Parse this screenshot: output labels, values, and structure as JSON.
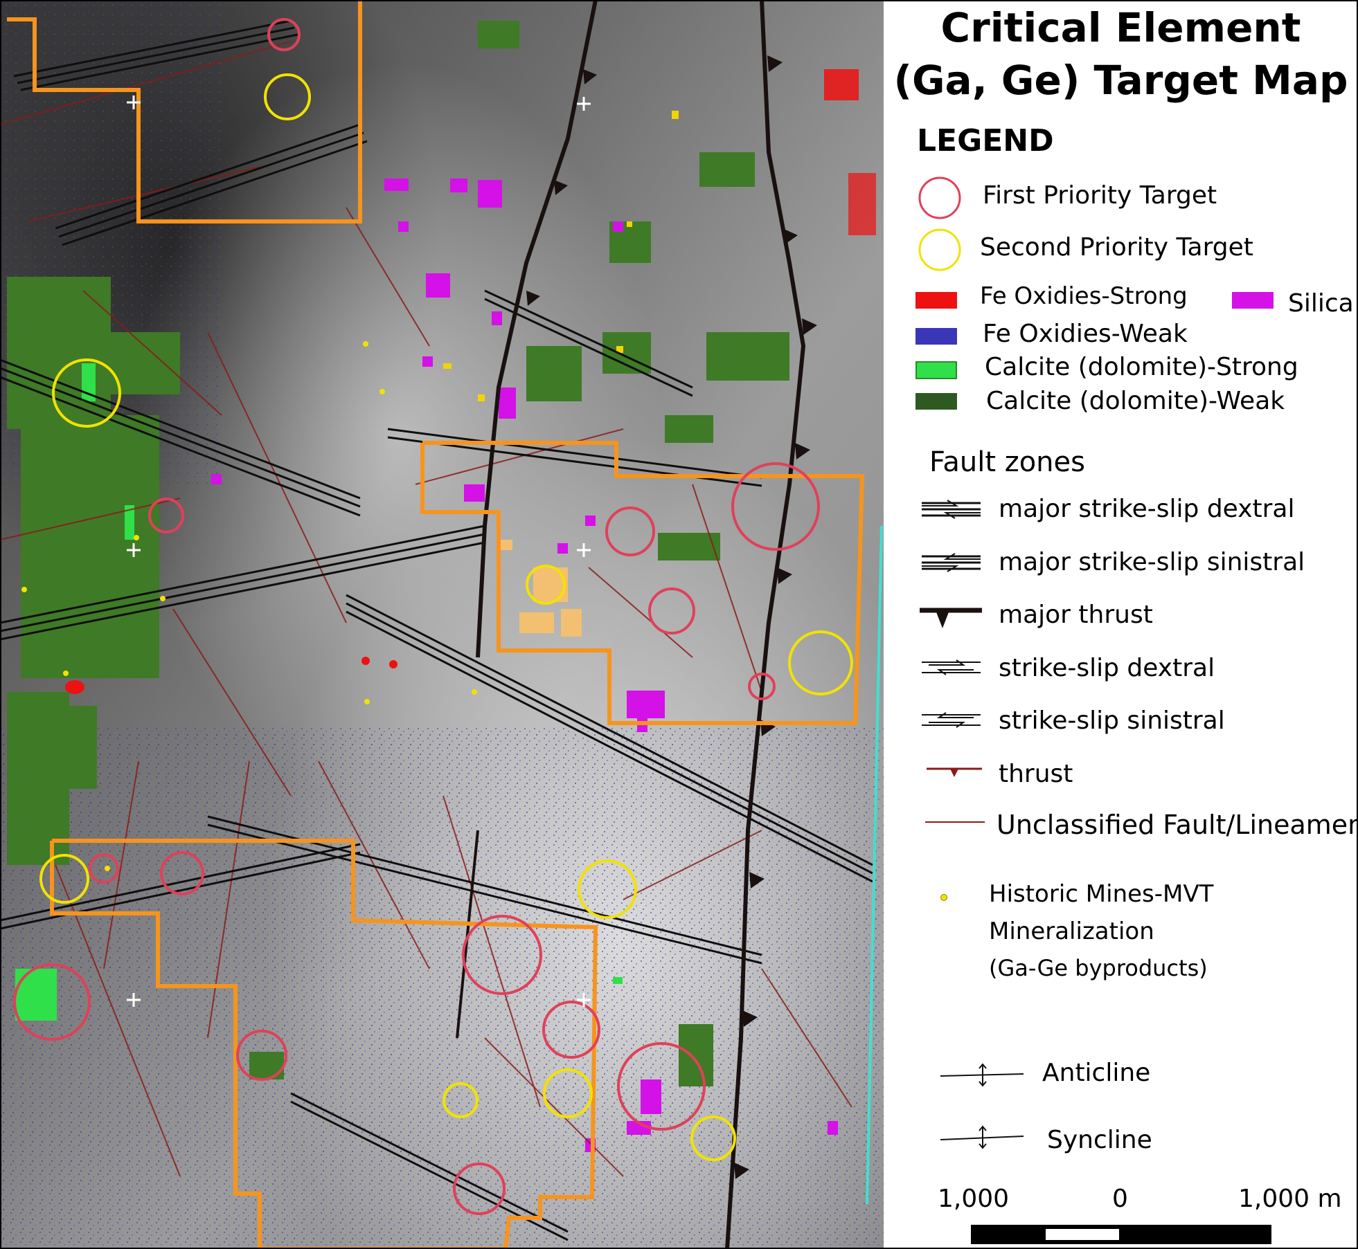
{
  "title": {
    "line1": "Critical Element",
    "line2": "(Ga, Ge) Target Map"
  },
  "legend": {
    "heading": "LEGEND",
    "items": [
      {
        "label": "First Priority Target",
        "symbol": "circle",
        "color": "#e0405a"
      },
      {
        "label": "Second Priority Target",
        "symbol": "circle",
        "color": "#f2e200"
      },
      {
        "label": "Fe Oxidies-Strong",
        "symbol": "swatch",
        "color": "#ee1111"
      },
      {
        "label": "Silica",
        "symbol": "swatch",
        "color": "#d411e6"
      },
      {
        "label": "Fe Oxidies-Weak",
        "symbol": "swatch",
        "color": "#3b35b8"
      },
      {
        "label": "Calcite (dolomite)-Strong",
        "symbol": "swatch",
        "color": "#2fe04a"
      },
      {
        "label": "Calcite (dolomite)-Weak",
        "symbol": "swatch",
        "color": "#2e5a22"
      }
    ],
    "fault_heading": "Fault zones",
    "faults": [
      {
        "label": "major strike-slip dextral",
        "symbol": "dextral-major-icon"
      },
      {
        "label": "major strike-slip sinistral",
        "symbol": "sinistral-major-icon"
      },
      {
        "label": "major thrust",
        "symbol": "major-thrust-icon"
      },
      {
        "label": "strike-slip dextral",
        "symbol": "dextral-icon"
      },
      {
        "label": "strike-slip sinistral",
        "symbol": "sinistral-icon"
      },
      {
        "label": "thrust",
        "symbol": "thrust-icon"
      },
      {
        "label": "Unclassified Fault/Lineament",
        "symbol": "lineament-icon"
      }
    ],
    "mines": {
      "line1": "Historic Mines-MVT",
      "line2": "Mineralization",
      "line3": "(Ga-Ge byproducts)",
      "color": "#f2e200"
    },
    "folds": [
      {
        "label": "Anticline",
        "symbol": "anticline-icon"
      },
      {
        "label": "Syncline",
        "symbol": "syncline-icon"
      }
    ]
  },
  "scale_bar": {
    "left": "1,000",
    "center": "0",
    "right": "1,000 m"
  },
  "colors": {
    "claim_boundary": "#f7941d",
    "first_priority": "#e0405a",
    "second_priority": "#f2e200",
    "fault_major": "#111111",
    "fault_minor": "#8b1a1a"
  }
}
